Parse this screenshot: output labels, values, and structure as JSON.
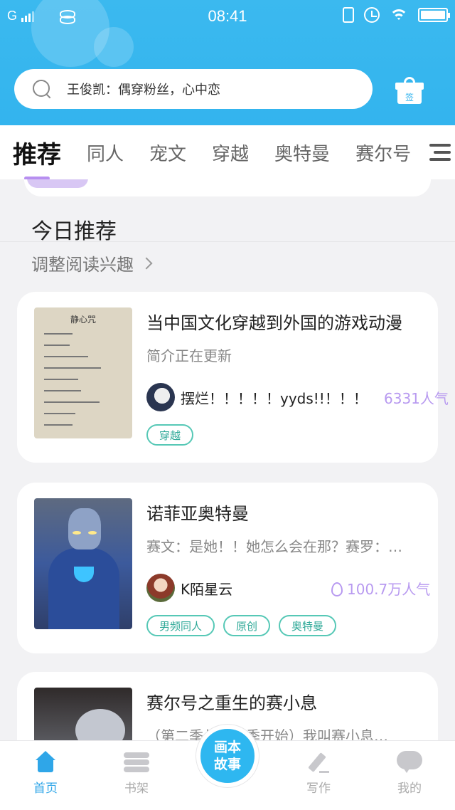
{
  "status_bar": {
    "carrier": "G",
    "time": "08:41"
  },
  "search": {
    "placeholder": "王俊凯：偶穿粉丝，心中恋",
    "gift_label": "签"
  },
  "tabs": [
    "推荐",
    "同人",
    "宠文",
    "穿越",
    "奥特曼",
    "赛尔号"
  ],
  "section": {
    "title": "今日推荐",
    "adjust_label": "调整阅读兴趣"
  },
  "books": [
    {
      "title": "当中国文化穿越到外国的游戏动漫",
      "description": "简介正在更新",
      "author": "摆烂！！！！！yyds!!！！！",
      "popularity": "6331人气",
      "tags": [
        "穿越"
      ],
      "cover_text": "静心咒"
    },
    {
      "title": "诺菲亚奥特曼",
      "description": "赛文：是她！！她怎么会在那？赛罗：…",
      "author": "K陌星云",
      "popularity": "100.7万人气",
      "tags": [
        "男频同人",
        "原创",
        "奥特曼"
      ]
    },
    {
      "title": "赛尔号之重生的赛小息",
      "description": "（第二季从第一季开始）我叫赛小息…"
    }
  ],
  "bottom_nav": {
    "home": "首页",
    "bookshelf": "书架",
    "center": [
      "画本",
      "故事"
    ],
    "write": "写作",
    "mine": "我的"
  },
  "colors": {
    "header": "#33b4ee",
    "accent": "#b78ff0",
    "tag": "#56c8b6",
    "nav_active": "#2fa6e8"
  }
}
